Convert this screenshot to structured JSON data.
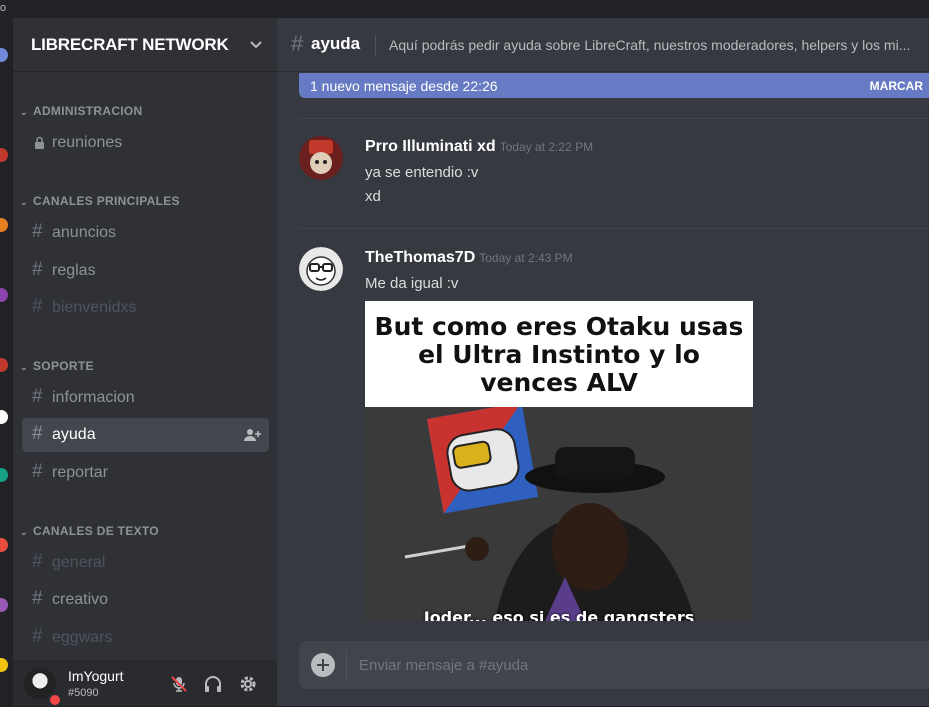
{
  "titlebar": {
    "glyph": "o"
  },
  "server": {
    "name": "LIBRECRAFT NETWORK",
    "chevron_icon": "chevron-down-icon"
  },
  "categories": [
    {
      "name": "ADMINISTRACION",
      "channels": [
        {
          "name": "reuniones",
          "icon": "lock-icon"
        }
      ]
    },
    {
      "name": "CANALES PRINCIPALES",
      "channels": [
        {
          "name": "anuncios"
        },
        {
          "name": "reglas"
        },
        {
          "name": "bienvenidxs"
        }
      ]
    },
    {
      "name": "SOPORTE",
      "channels": [
        {
          "name": "informacion"
        },
        {
          "name": "ayuda",
          "active": true
        },
        {
          "name": "reportar"
        }
      ]
    },
    {
      "name": "CANALES DE TEXTO",
      "channels": [
        {
          "name": "general"
        },
        {
          "name": "creativo"
        },
        {
          "name": "eggwars"
        }
      ]
    }
  ],
  "hash_glyph": "#",
  "user": {
    "name": "ImYogurt",
    "tag": "#5090",
    "status_color": "#f04747"
  },
  "channel_header": {
    "hash": "#",
    "name": "ayuda",
    "topic": "Aquí podrás pedir ayuda sobre LibreCraft, nuestros moderadores, helpers y los mi..."
  },
  "new_messages_bar": {
    "text": "1 nuevo mensaje desde 22:26",
    "action": "MARCAR"
  },
  "messages": [
    {
      "author": "Prro Illuminati xd",
      "timestamp": "Today at 2:22 PM",
      "lines": [
        "ya se entendio :v",
        "xd"
      ]
    },
    {
      "author": "TheThomas7D",
      "timestamp": "Today at 2:43 PM",
      "lines": [
        "Me da igual :v"
      ],
      "attachment": {
        "caption": "But como eres Otaku usas el Ultra Instinto y lo vences ALV",
        "subtitle": "Joder... eso si es de gangsters"
      }
    }
  ],
  "composer": {
    "placeholder": "Enviar mensaje a #ayuda",
    "add_icon": "plus-circle-icon"
  },
  "colors": {
    "accent": "#677bc4",
    "background": "#36393f",
    "sidebar": "#2f3136",
    "dnd": "#f04747"
  }
}
